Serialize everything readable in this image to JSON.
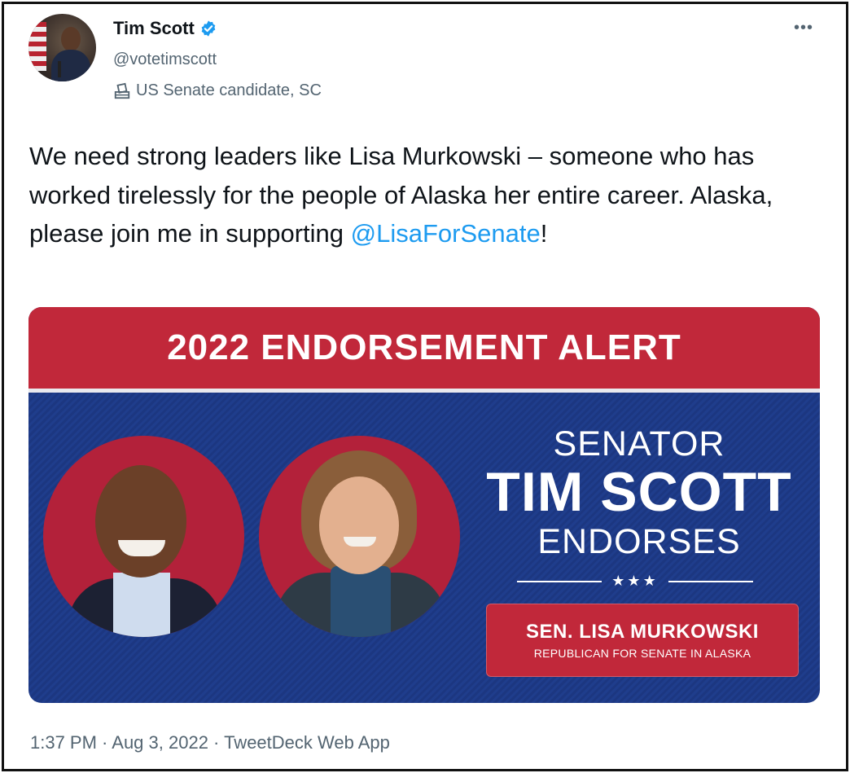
{
  "author": {
    "name": "Tim Scott",
    "handle": "@votetimscott",
    "label": "US Senate candidate, SC"
  },
  "menu": {
    "more": "•••"
  },
  "tweet": {
    "text": "We need strong leaders like Lisa Murkowski – someone who has worked tirelessly for the people of Alaska her entire career. Alaska, please join me in supporting ",
    "mention": "@LisaForSenate",
    "end": "!"
  },
  "card": {
    "banner": "2022 ENDORSEMENT ALERT",
    "line1": "SENATOR",
    "line2": "TIM SCOTT",
    "line3": "ENDORSES",
    "stars": "★★★",
    "endorsee_name": "SEN. LISA MURKOWSKI",
    "endorsee_sub": "REPUBLICAN FOR SENATE IN ALASKA"
  },
  "meta": {
    "timestamp": "1:37 PM · Aug 3, 2022 · TweetDeck Web App"
  },
  "colors": {
    "link": "#1d9bf0",
    "banner_red": "#c1283a",
    "card_blue": "#1f3d8c",
    "verified": "#1d9bf0"
  },
  "icons": {
    "verified": "verified-badge-icon",
    "label": "ballot-box-icon",
    "more": "more-options-icon"
  }
}
